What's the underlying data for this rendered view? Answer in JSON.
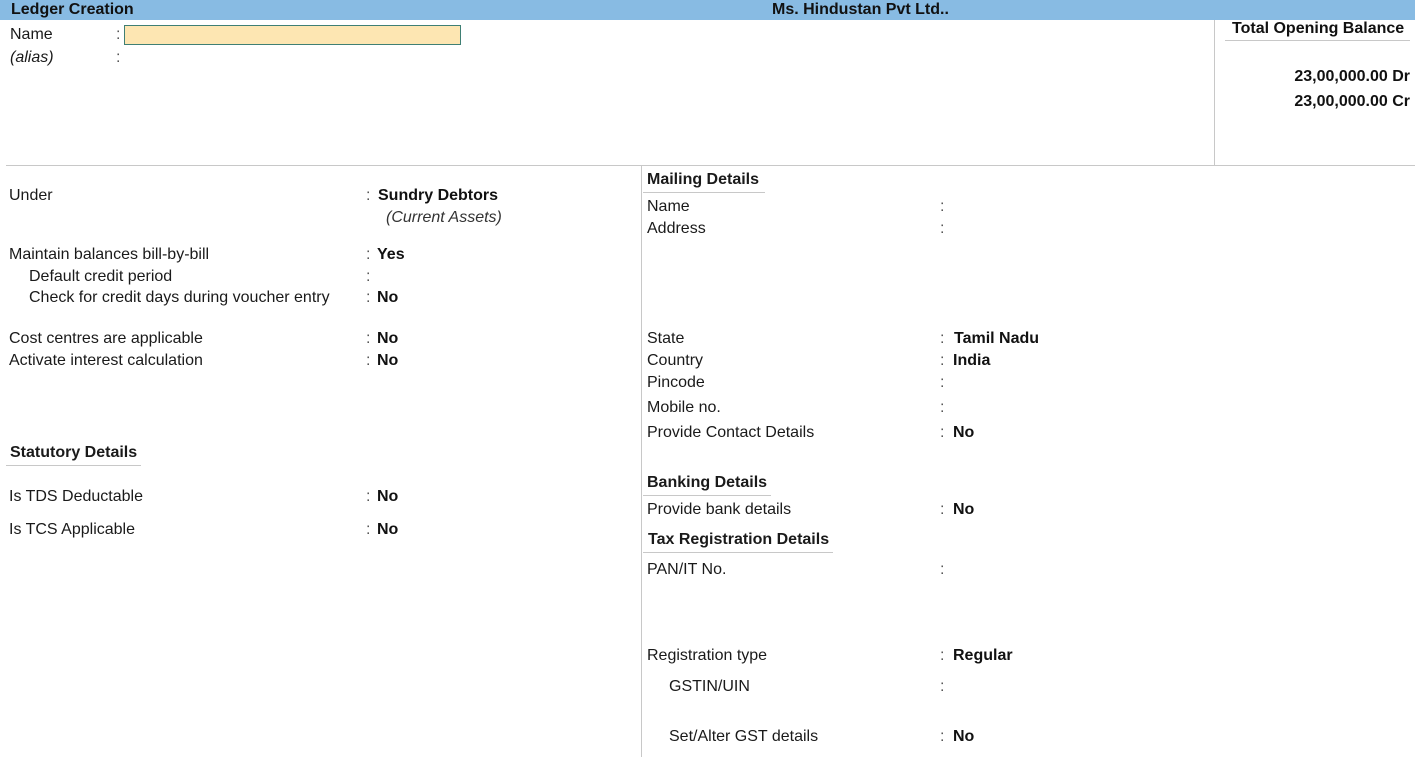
{
  "titlebar": {
    "title": "Ledger Creation",
    "company": "Ms. Hindustan Pvt Ltd.."
  },
  "header": {
    "name_label": "Name",
    "name_value": "",
    "alias_label": "(alias)",
    "colon": ":"
  },
  "opening_balance": {
    "title": "Total Opening Balance",
    "debit": "23,00,000.00 Dr",
    "credit": "23,00,000.00 Cr"
  },
  "left": {
    "under": {
      "label": "Under",
      "value": "Sundry Debtors",
      "sub": "(Current Assets)"
    },
    "bill_by_bill": {
      "label": "Maintain balances bill-by-bill",
      "value": "Yes"
    },
    "default_credit": {
      "label": "Default credit period",
      "value": ""
    },
    "check_credit": {
      "label": "Check for credit days during voucher entry",
      "value": "No"
    },
    "cost_centres": {
      "label": "Cost centres are applicable",
      "value": "No"
    },
    "interest": {
      "label": "Activate interest calculation",
      "value": "No"
    },
    "statutory_title": "Statutory Details",
    "tds": {
      "label": "Is TDS Deductable",
      "value": "No"
    },
    "tcs": {
      "label": "Is TCS Applicable",
      "value": "No"
    }
  },
  "mailing": {
    "title": "Mailing Details",
    "name": {
      "label": "Name",
      "value": ""
    },
    "address": {
      "label": "Address",
      "value": ""
    },
    "state": {
      "label": "State",
      "value": "Tamil Nadu"
    },
    "country": {
      "label": "Country",
      "value": "India"
    },
    "pincode": {
      "label": "Pincode",
      "value": ""
    },
    "mobile": {
      "label": "Mobile no.",
      "value": ""
    },
    "contact": {
      "label": "Provide Contact Details",
      "value": "No"
    }
  },
  "banking": {
    "title": "Banking Details",
    "bank": {
      "label": "Provide bank details",
      "value": "No"
    }
  },
  "tax": {
    "title": "Tax Registration Details",
    "pan": {
      "label": "PAN/IT No.",
      "value": ""
    },
    "reg_type": {
      "label": "Registration type",
      "value": "Regular"
    },
    "gstin": {
      "label": "GSTIN/UIN",
      "value": ""
    },
    "gst_details": {
      "label": "Set/Alter GST details",
      "value": "No"
    }
  }
}
